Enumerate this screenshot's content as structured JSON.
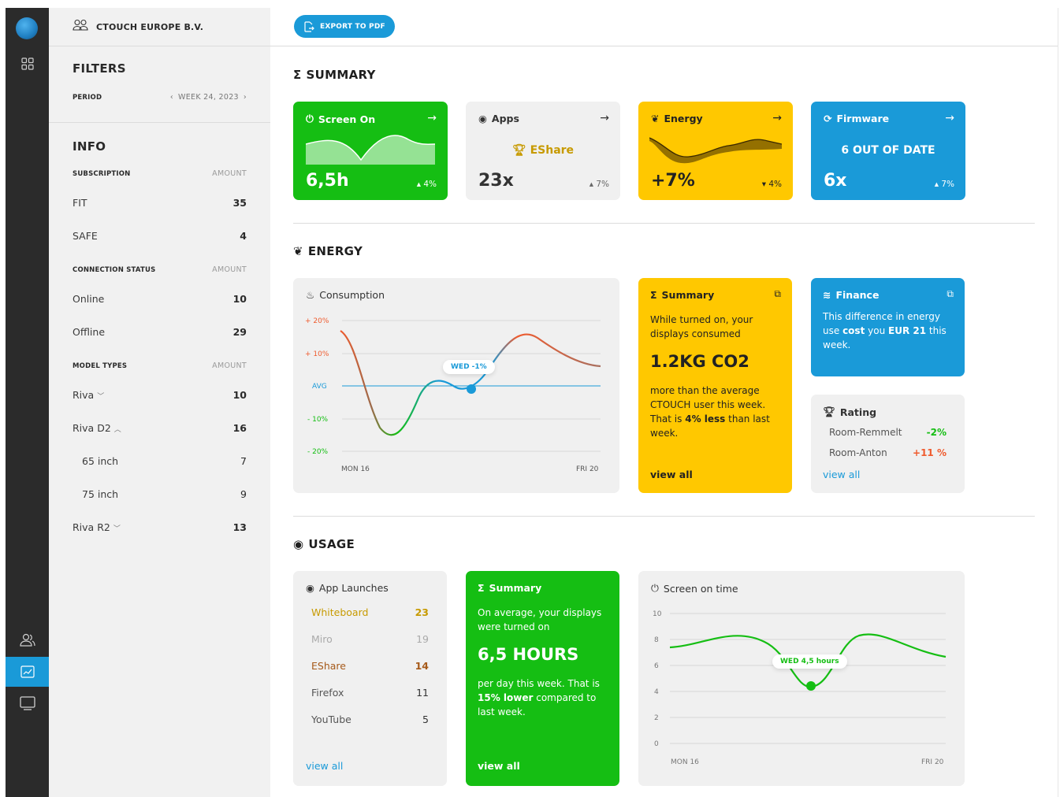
{
  "org": {
    "name": "CTOUCH EUROPE B.V."
  },
  "filters": {
    "title": "FILTERS",
    "period_label": "PERIOD",
    "period_value": "WEEK 24, 2023"
  },
  "info": {
    "title": "INFO",
    "subscription": {
      "header": "SUBSCRIPTION",
      "amount_header": "AMOUNT",
      "items": [
        {
          "label": "FIT",
          "value": "35"
        },
        {
          "label": "SAFE",
          "value": "4"
        }
      ]
    },
    "connection": {
      "header": "CONNECTION STATUS",
      "amount_header": "AMOUNT",
      "items": [
        {
          "label": "Online",
          "value": "10"
        },
        {
          "label": "Offline",
          "value": "29"
        }
      ]
    },
    "models": {
      "header": "MODEL TYPES",
      "amount_header": "AMOUNT",
      "items": [
        {
          "label": "Riva",
          "value": "10"
        },
        {
          "label": "Riva D2",
          "value": "16"
        },
        {
          "label": "65 inch",
          "value": "7"
        },
        {
          "label": "75 inch",
          "value": "9"
        },
        {
          "label": "Riva R2",
          "value": "13"
        }
      ]
    }
  },
  "toolbar": {
    "export_label": "EXPORT TO PDF"
  },
  "summary": {
    "title": "SUMMARY",
    "cards": {
      "screen_on": {
        "title": "Screen On",
        "value": "6,5h",
        "delta": "4%",
        "delta_dir": "up"
      },
      "apps": {
        "title": "Apps",
        "top_app": "EShare",
        "value": "23x",
        "delta": "7%",
        "delta_dir": "up"
      },
      "energy": {
        "title": "Energy",
        "value": "+7%",
        "delta": "4%",
        "delta_dir": "down"
      },
      "firmware": {
        "title": "Firmware",
        "status": "6 OUT OF DATE",
        "value": "6x",
        "delta": "7%",
        "delta_dir": "up"
      }
    }
  },
  "energy": {
    "title": "ENERGY",
    "consumption": {
      "title": "Consumption",
      "y_labels": [
        "+ 20%",
        "+ 10%",
        "AVG",
        "- 10%",
        "- 20%"
      ],
      "x_start": "MON 16",
      "x_end": "FRI 20",
      "marker_label": "WED -1%"
    },
    "summary_card": {
      "title": "Summary",
      "text1": "While turned on, your displays consumed",
      "big": "1.2KG CO2",
      "text2_a": "more than the average CTOUCH user this week. That is ",
      "text2_b": "4% less",
      "text2_c": " than last week.",
      "link": "view all"
    },
    "finance": {
      "title": "Finance",
      "text_a": "This difference in energy use ",
      "text_b": "cost",
      "text_c": " you ",
      "text_d": "EUR 21",
      "text_e": " this week."
    },
    "rating": {
      "title": "Rating",
      "items": [
        {
          "label": "Room-Remmelt",
          "value": "-2%",
          "color": "#15be13"
        },
        {
          "label": "Room-Anton",
          "value": "+11 %",
          "color": "#ef5b2e"
        }
      ],
      "link": "view all"
    }
  },
  "usage": {
    "title": "USAGE",
    "app_launches": {
      "title": "App Launches",
      "items": [
        {
          "label": "Whiteboard",
          "value": "23",
          "color": "#c79a00"
        },
        {
          "label": "Miro",
          "value": "19",
          "color": "#aaaaaa"
        },
        {
          "label": "EShare",
          "value": "14",
          "color": "#a65a1a"
        },
        {
          "label": "Firefox",
          "value": "11",
          "color": "#555555"
        },
        {
          "label": "YouTube",
          "value": "5",
          "color": "#555555"
        }
      ],
      "link": "view all"
    },
    "summary_card": {
      "title": "Summary",
      "text1": "On average, your displays were turned on",
      "big": "6,5 HOURS",
      "text2_a": "per day this week. That is ",
      "text2_b": "15% lower",
      "text2_c": " compared to last week.",
      "link": "view all"
    },
    "screen_time": {
      "title": "Screen on time",
      "y_labels": [
        "10",
        "8",
        "6",
        "4",
        "2",
        "0"
      ],
      "x_start": "MON 16",
      "x_end": "FRI 20",
      "marker_label": "WED 4,5 hours"
    }
  },
  "colors": {
    "green": "#15be13",
    "yellow": "#ffc800",
    "blue": "#1a9ad8",
    "grey": "#f0f0f0"
  }
}
